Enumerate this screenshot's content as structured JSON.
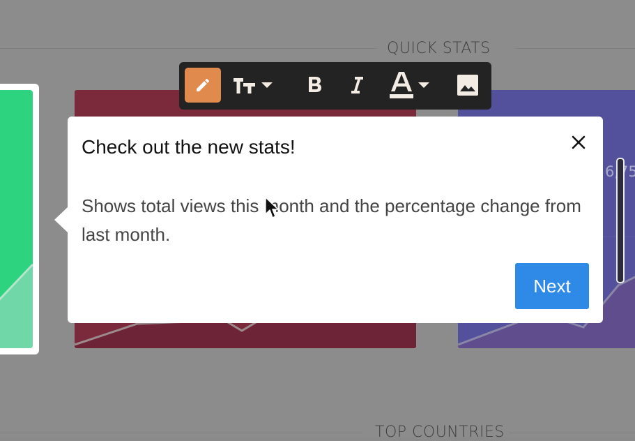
{
  "page": {
    "quick_stats_title": "QUICK STATS",
    "top_countries_title": "TOP COUNTRIES",
    "blue_card_value_partial": "6,75"
  },
  "toolbar": {
    "items": [
      {
        "name": "edit",
        "icon": "pencil-icon",
        "active": true
      },
      {
        "name": "text-size",
        "icon": "text-size-icon",
        "dropdown": true
      },
      {
        "name": "bold",
        "icon": "bold-icon"
      },
      {
        "name": "italic",
        "icon": "italic-icon"
      },
      {
        "name": "text-color",
        "icon": "text-color-icon",
        "dropdown": true
      },
      {
        "name": "image",
        "icon": "image-icon"
      }
    ],
    "active_color": "#e08a4e"
  },
  "popover": {
    "title": "Check out the new stats!",
    "body": "Shows total views this month and the percentage change from last month.",
    "next_label": "Next",
    "close_icon": "close-icon",
    "button_color": "#2e8ae6"
  },
  "colors": {
    "green_card": "#2ed37f",
    "red_card": "#7a2a3a",
    "blue_card": "#54519c"
  }
}
